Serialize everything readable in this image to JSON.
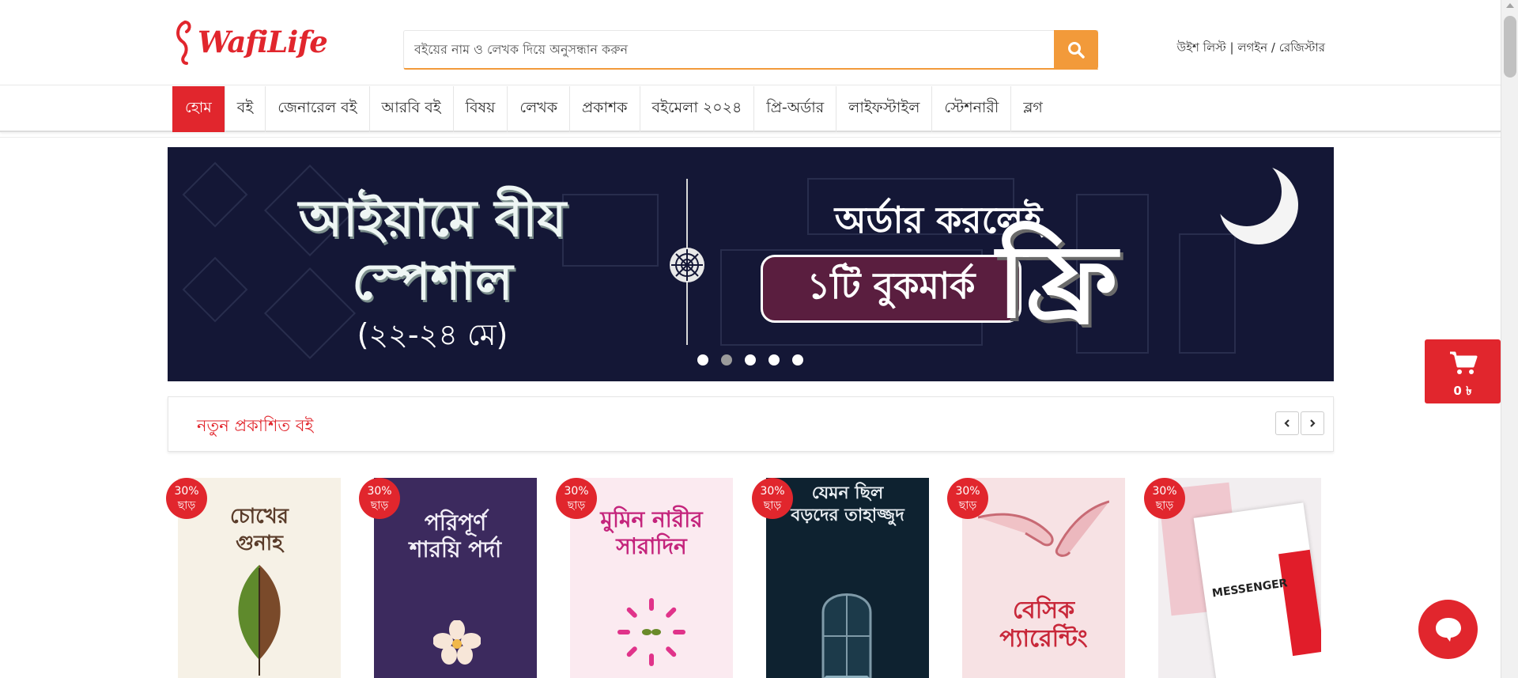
{
  "header": {
    "logo_text": "WafiLife",
    "search": {
      "placeholder": "বইয়ের নাম ও লেখক দিয়ে অনুসন্ধান করুন"
    },
    "links": {
      "wishlist": "উইশ লিস্ট",
      "login": "লগইন",
      "register": "রেজিস্টার"
    }
  },
  "nav": {
    "items": [
      "হোম",
      "বই",
      "জেনারেল বই",
      "আরবি বই",
      "বিষয়",
      "লেখক",
      "প্রকাশক",
      "বইমেলা ২০২৪",
      "প্রি-অর্ডার",
      "লাইফস্টাইল",
      "স্টেশনারী",
      "ব্লগ"
    ],
    "active_index": 0
  },
  "banner": {
    "left_line1": "আইয়ামে বীয",
    "left_line2": "স্পেশাল",
    "date_range": "(২২-২৪ মে)",
    "right_line1": "অর্ডার করলেই",
    "pill_text": "১টি বুকমার্ক",
    "free_text": "ফ্রি",
    "slide_count": 5,
    "active_slide": 1
  },
  "section": {
    "title": "নতুন প্রকাশিত বই"
  },
  "books": [
    {
      "title": "চোখের গুনাহ",
      "discount_line1": "30%",
      "discount_line2": "ছাড়"
    },
    {
      "title": "পরিপূর্ণ শারয়ি পর্দা",
      "discount_line1": "30%",
      "discount_line2": "ছাড়"
    },
    {
      "title": "মুমিন নারীর সারাদিন",
      "discount_line1": "30%",
      "discount_line2": "ছাড়"
    },
    {
      "title": "যেমন ছিল বড়দের তাহাজ্জুদ",
      "discount_line1": "30%",
      "discount_line2": "ছাড়"
    },
    {
      "title": "বেসিক প্যারেন্টিং",
      "discount_line1": "30%",
      "discount_line2": "ছাড়"
    },
    {
      "title": "MESSENGER",
      "discount_line1": "30%",
      "discount_line2": "ছাড়"
    }
  ],
  "cart": {
    "count": "0 ৳"
  },
  "colors": {
    "brand_red": "#e1262d",
    "search_orange": "#f29a3a",
    "banner_navy": "#141736"
  }
}
